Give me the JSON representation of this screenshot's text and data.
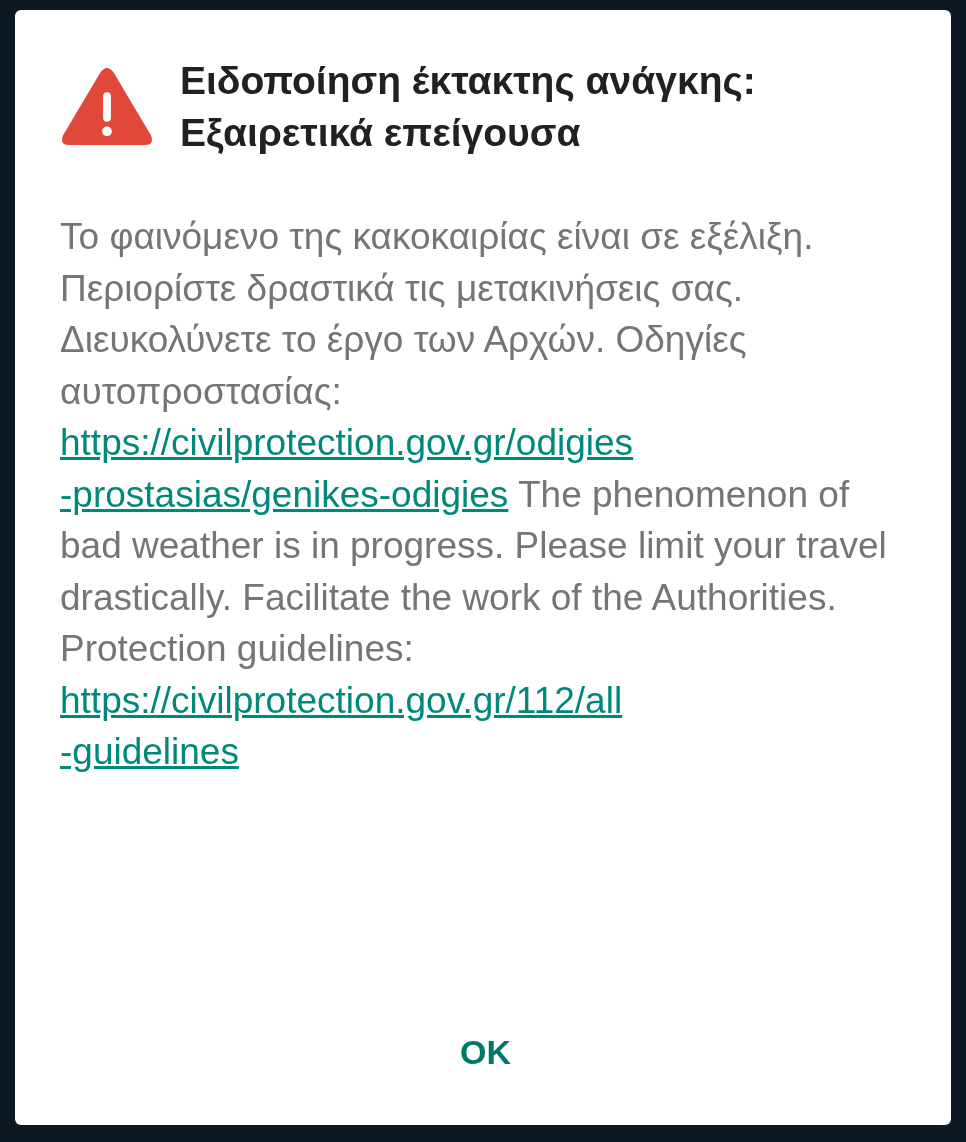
{
  "dialog": {
    "title_lines": [
      "Ειδοποίηση έκτακτης ανάγκης:",
      "Εξαιρετικά επείγουσα"
    ],
    "body": [
      {
        "kind": "text",
        "text": "Το φαινόμενο της κακοκαιρίας είναι σε εξέλιξη. Περιορίστε δραστικά τις μετακινήσεις σας. Διευκολύνετε το έργο των Αρχών. Οδηγίες αυτοπροστασίας:"
      },
      {
        "kind": "link",
        "lines": [
          "https://civilprotection.gov.gr/odigies",
          "-prostasias/genikes-odigies"
        ]
      },
      {
        "kind": "text",
        "text": "The phenomenon of bad weather is in progress. Please limit your travel drastically. Facilitate the work of the Authorities. Protection guidelines:"
      },
      {
        "kind": "link",
        "lines": [
          "https://civilprotection.gov.gr/112/all",
          "-guidelines"
        ]
      }
    ],
    "button": "OK"
  }
}
